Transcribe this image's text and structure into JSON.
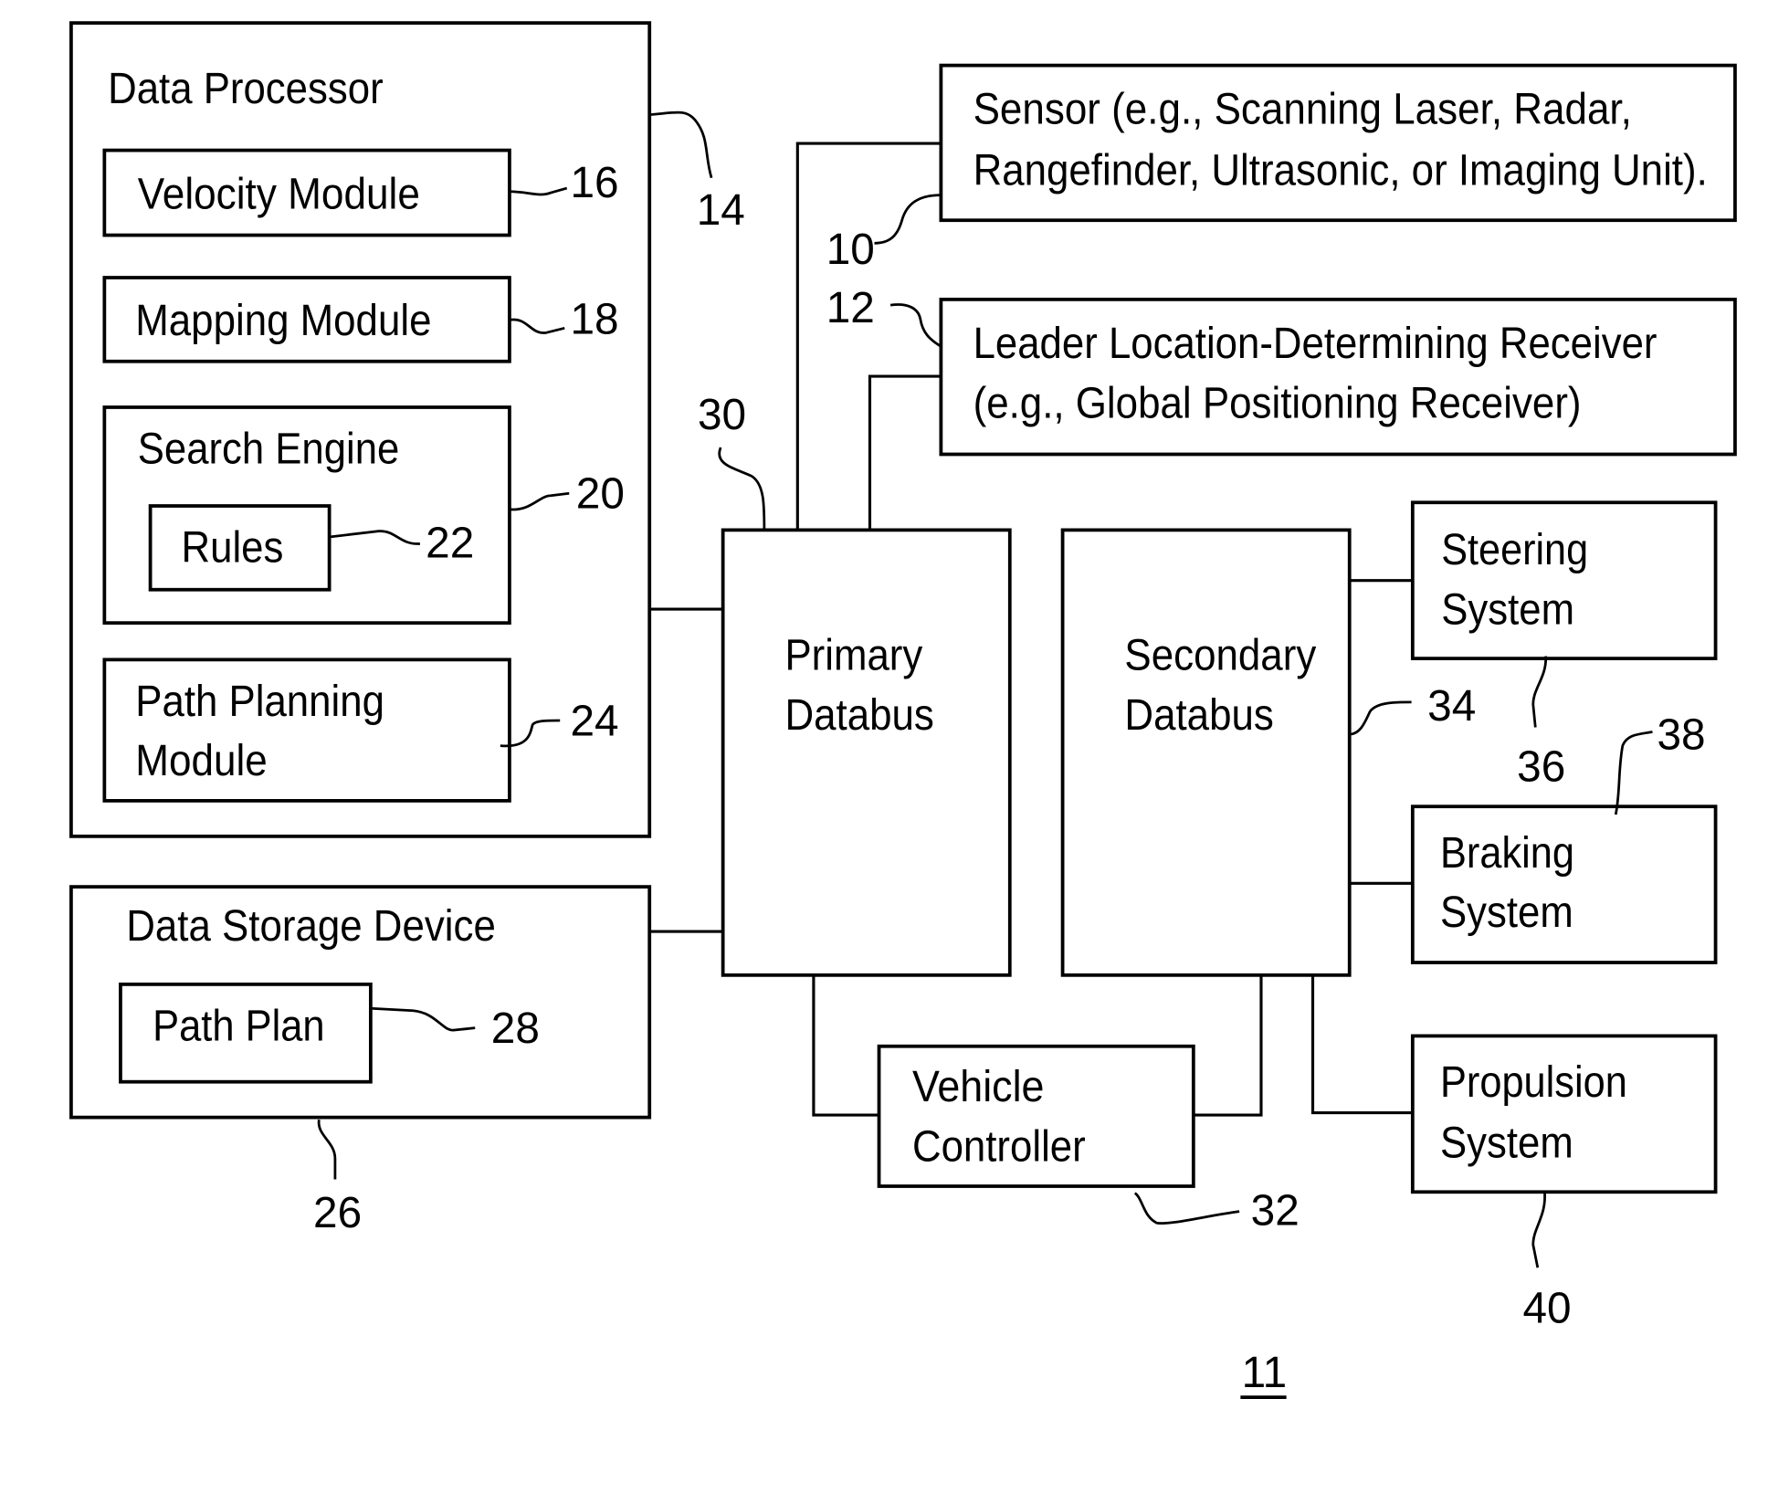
{
  "diagram": {
    "figure_number": "11",
    "blocks": {
      "data_processor": {
        "title": "Data Processor",
        "ref": "14"
      },
      "velocity_module": {
        "label": "Velocity Module",
        "ref": "16"
      },
      "mapping_module": {
        "label": "Mapping Module",
        "ref": "18"
      },
      "search_engine": {
        "title": "Search Engine",
        "ref": "20"
      },
      "rules": {
        "label": "Rules",
        "ref": "22"
      },
      "path_planning_module": {
        "line1": "Path Planning",
        "line2": "Module",
        "ref": "24"
      },
      "data_storage_device": {
        "title": "Data Storage Device",
        "ref": "26"
      },
      "path_plan": {
        "label": "Path Plan",
        "ref": "28"
      },
      "sensor": {
        "line1": "Sensor (e.g., Scanning Laser, Radar,",
        "line2": "Rangefinder, Ultrasonic, or Imaging Unit).",
        "ref": "10"
      },
      "leader_receiver": {
        "line1": "Leader Location-Determining Receiver",
        "line2": "(e.g., Global Positioning Receiver)",
        "ref": "12"
      },
      "primary_databus": {
        "line1": "Primary",
        "line2": "Databus",
        "ref": "30"
      },
      "secondary_databus": {
        "line1": "Secondary",
        "line2": "Databus",
        "ref": "34"
      },
      "vehicle_controller": {
        "line1": "Vehicle",
        "line2": "Controller",
        "ref": "32"
      },
      "steering_system": {
        "line1": "Steering",
        "line2": "System",
        "ref": "36"
      },
      "braking_system": {
        "line1": "Braking",
        "line2": "System",
        "ref": "38"
      },
      "propulsion_system": {
        "line1": "Propulsion",
        "line2": "System",
        "ref": "40"
      }
    }
  }
}
